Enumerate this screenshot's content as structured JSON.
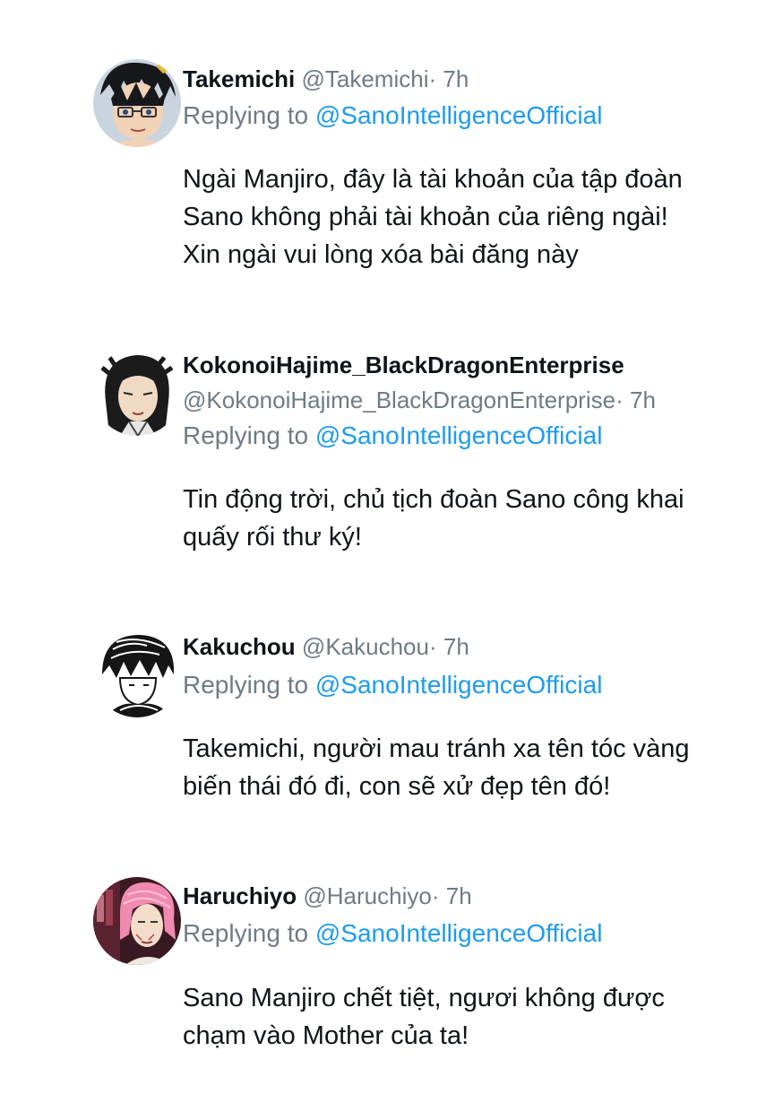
{
  "replies": [
    {
      "name": "Takemichi",
      "handle": "@Takemichi",
      "dot": "·",
      "time": "7h",
      "replying_prefix": "Replying to",
      "mention": "@SanoIntelligenceOfficial",
      "text_lines": [
        "Ngài Manjiro, đây là tài khoản của tập đoàn",
        "Sano không phải tài khoản của riêng ngài!",
        "Xin ngài vui lòng xóa bài đăng này"
      ]
    },
    {
      "name": "KokonoiHajime_BlackDragonEnterprise",
      "handle": "@KokonoiHajime_BlackDragonEnterprise",
      "dot": "·",
      "time": "7h",
      "replying_prefix": "Replying to",
      "mention": "@SanoIntelligenceOfficial",
      "text_lines": [
        "Tin động trời, chủ tịch đoàn Sano công khai",
        "quấy rối thư ký!"
      ]
    },
    {
      "name": "Kakuchou",
      "handle": "@Kakuchou",
      "dot": "·",
      "time": "7h",
      "replying_prefix": "Replying to",
      "mention": "@SanoIntelligenceOfficial",
      "text_lines": [
        "Takemichi, người mau tránh xa tên tóc vàng",
        "biến thái đó đi, con sẽ xử đẹp tên đó!"
      ]
    },
    {
      "name": "Haruchiyo",
      "handle": "@Haruchiyo",
      "dot": "·",
      "time": "7h",
      "replying_prefix": "Replying to",
      "mention": "@SanoIntelligenceOfficial",
      "text_lines": [
        "Sano Manjiro chết tiệt, ngươi không được",
        "chạm vào Mother của ta!"
      ]
    }
  ]
}
